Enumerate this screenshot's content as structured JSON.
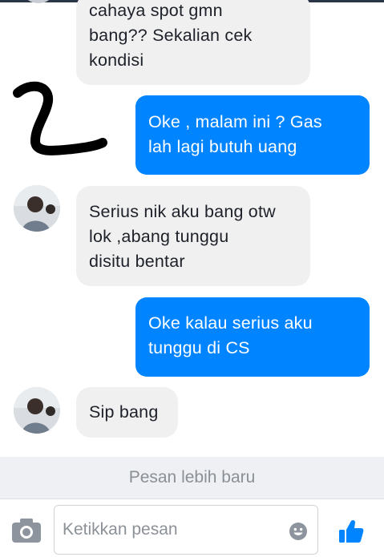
{
  "messages": [
    {
      "from": "them",
      "lines": [
        "cahaya spot gmn",
        "bang?? Sekalian cek",
        "kondisi"
      ]
    },
    {
      "from": "me",
      "lines": [
        "Oke , malam ini ? Gas",
        "lah lagi butuh uang"
      ]
    },
    {
      "from": "them",
      "lines": [
        "Serius nik aku bang otw",
        "lok ,abang tunggu",
        "disitu bentar"
      ]
    },
    {
      "from": "me",
      "lines": [
        "Oke kalau serius aku",
        "tunggu di CS"
      ]
    },
    {
      "from": "them",
      "lines": [
        "Sip bang"
      ]
    }
  ],
  "newer_messages_label": "Pesan lebih baru",
  "composer": {
    "placeholder": "Ketikkan pesan"
  },
  "colors": {
    "outgoing_bubble": "#0084ff",
    "incoming_bubble": "#f1f0f0",
    "like_button": "#0084ff",
    "icon_gray": "#8d949e"
  },
  "icons": {
    "camera": "camera-icon",
    "emoji": "emoji-icon",
    "like": "thumbs-up-icon"
  }
}
